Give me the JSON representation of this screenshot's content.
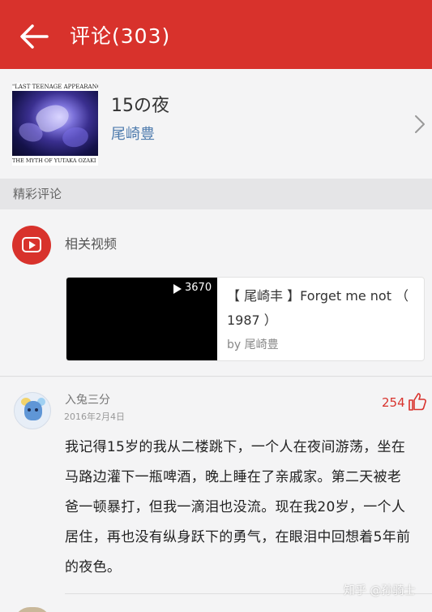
{
  "header": {
    "title": "评论(303)",
    "back_icon": "arrow-left-icon",
    "background_color": "#d8322c"
  },
  "song": {
    "title": "15の夜",
    "artist": "尾崎豊",
    "album_top_text": "\"LAST TEENAGE APPEARANCE\"",
    "album_bottom_text": "THE MYTH OF YUTAKA OZAKI",
    "chevron_icon": "chevron-right-icon"
  },
  "section": {
    "title": "精彩评论"
  },
  "related_video": {
    "label": "相关视频",
    "icon": "video-play-icon",
    "card": {
      "play_count": "3670",
      "title": "【 尾崎丰 】Forget me not （ 1987 ）",
      "by": "by 尾崎豊"
    }
  },
  "comment": {
    "user": "入兔三分",
    "date": "2016年2月4日",
    "likes": "254",
    "like_icon": "thumbs-up-icon",
    "text": "我记得15岁的我从二楼跳下，一个人在夜间游荡，坐在马路边灌下一瓶啤酒，晚上睡在了亲戚家。第二天被老爸一顿暴打，但我一滴泪也没流。现在我20岁，一个人居住，再也没有纵身跃下的勇气，在眼泪中回想着5年前的夜色。"
  },
  "watermark": "知乎 @孙骑士",
  "colors": {
    "accent": "#d8322c",
    "link": "#4f7cae"
  }
}
